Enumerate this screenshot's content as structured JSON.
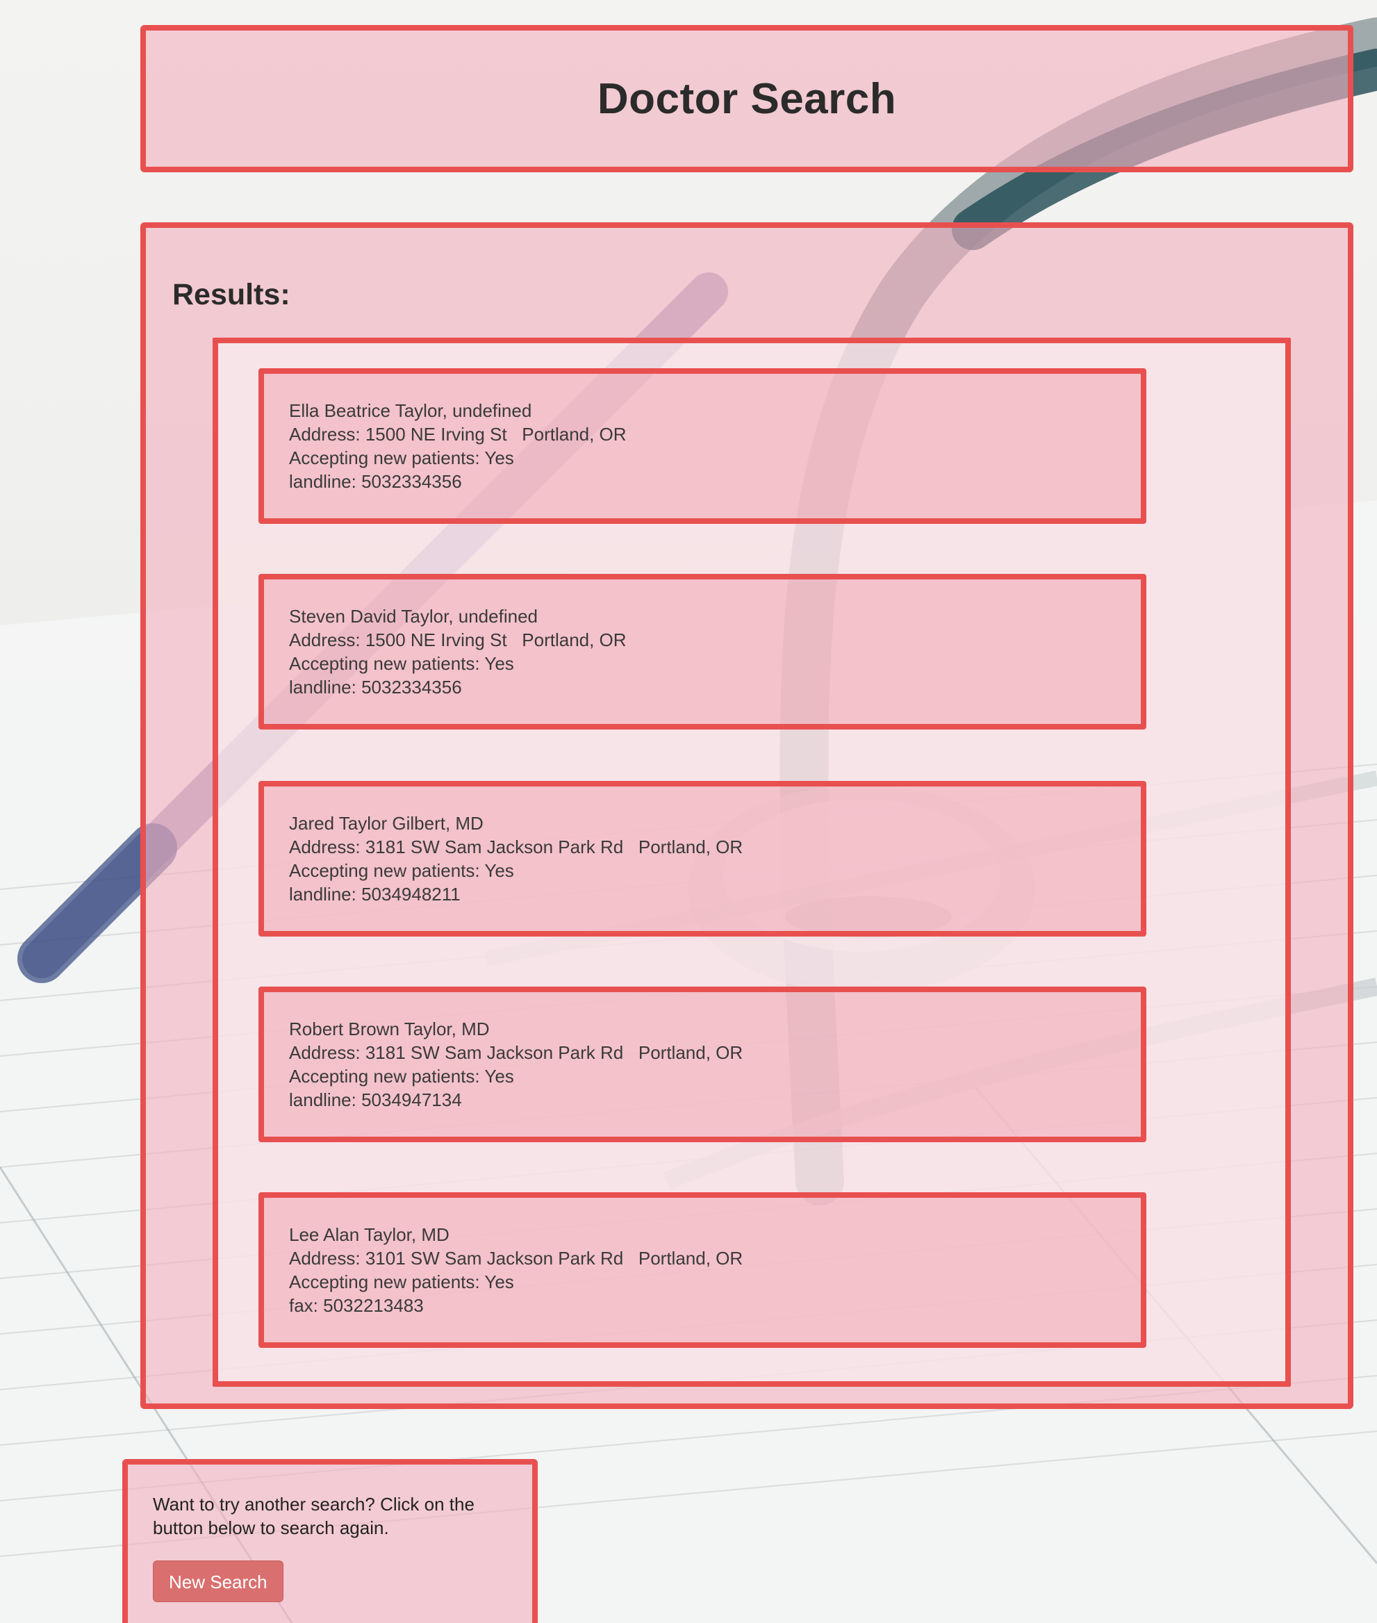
{
  "header": {
    "title": "Doctor Search"
  },
  "results": {
    "heading": "Results:",
    "doctors": [
      {
        "name_line": "Ella Beatrice Taylor, undefined",
        "address_line": "Address: 1500 NE Irving St   Portland, OR",
        "accepting_line": "Accepting new patients: Yes",
        "phone_line": "landline: 5032334356"
      },
      {
        "name_line": "Steven David Taylor, undefined",
        "address_line": "Address: 1500 NE Irving St   Portland, OR",
        "accepting_line": "Accepting new patients: Yes",
        "phone_line": "landline: 5032334356"
      },
      {
        "name_line": "Jared Taylor Gilbert, MD",
        "address_line": "Address: 3181 SW Sam Jackson Park Rd   Portland, OR",
        "accepting_line": "Accepting new patients: Yes",
        "phone_line": "landline: 5034948211"
      },
      {
        "name_line": "Robert Brown Taylor, MD",
        "address_line": "Address: 3181 SW Sam Jackson Park Rd   Portland, OR",
        "accepting_line": "Accepting new patients: Yes",
        "phone_line": "landline: 5034947134"
      },
      {
        "name_line": "Lee Alan Taylor, MD",
        "address_line": "Address: 3101 SW Sam Jackson Park Rd   Portland, OR",
        "accepting_line": "Accepting new patients: Yes",
        "phone_line": "fax: 5032213483"
      }
    ]
  },
  "footer": {
    "prompt": "Want to try another search? Click on the button below to search again.",
    "button_label": "New Search"
  },
  "colors": {
    "panel_border": "#e8504f",
    "panel_fill": "#f2b2c0",
    "button_bg": "#d9706f"
  },
  "background_image": {
    "icon": "stethoscope-icon"
  }
}
